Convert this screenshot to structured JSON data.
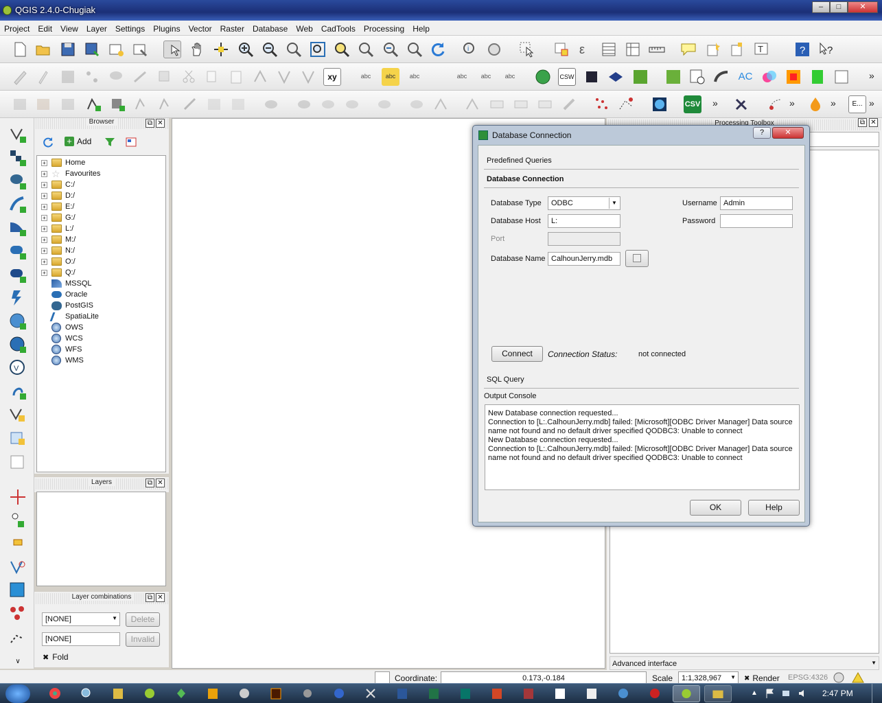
{
  "window": {
    "title": "QGIS 2.4.0-Chugiak"
  },
  "menu": [
    "Project",
    "Edit",
    "View",
    "Layer",
    "Settings",
    "Plugins",
    "Vector",
    "Raster",
    "Database",
    "Web",
    "CadTools",
    "Processing",
    "Help"
  ],
  "toolbars": {
    "row1_icons": [
      "new-project-icon",
      "open-project-icon",
      "save-project-icon",
      "save-as-icon",
      "new-print-composer-icon",
      "composer-manager-icon",
      "touch-zoom-icon",
      "pan-icon",
      "pan-to-selection-icon",
      "zoom-in-icon",
      "zoom-out-icon",
      "zoom-native-icon",
      "zoom-full-icon",
      "zoom-to-layer-icon",
      "zoom-to-selection-icon",
      "zoom-last-icon",
      "zoom-next-icon",
      "refresh-icon",
      "identify-icon",
      "action-icon",
      "select-icon",
      "deselect-icon",
      "measure-icon",
      "attribute-table-icon",
      "field-calculator-icon",
      "ruler-icon",
      "map-tips-icon",
      "bookmark-icon",
      "new-bookmark-icon",
      "text-annotation-icon",
      "help-icon",
      "whats-this-icon"
    ],
    "row2_abc": [
      "abc",
      "abc",
      "abc",
      "abc",
      "abc",
      "abc"
    ],
    "row2_labels": {
      "xy": "xy",
      "csw": "CSW",
      "ac": "AC"
    },
    "row3_labels": {
      "csv": "CSV",
      "more": "»",
      "edit": "E..."
    }
  },
  "browser": {
    "title": "Browser",
    "add_label": "Add",
    "items": [
      {
        "label": "Home",
        "type": "folder",
        "expand": true
      },
      {
        "label": "Favourites",
        "type": "star",
        "expand": true
      },
      {
        "label": "C:/",
        "type": "folder",
        "expand": true
      },
      {
        "label": "D:/",
        "type": "folder",
        "expand": true
      },
      {
        "label": "E:/",
        "type": "folder",
        "expand": true
      },
      {
        "label": "G:/",
        "type": "folder",
        "expand": true
      },
      {
        "label": "L:/",
        "type": "folder",
        "expand": true
      },
      {
        "label": "M:/",
        "type": "folder",
        "expand": true
      },
      {
        "label": "N:/",
        "type": "folder",
        "expand": true
      },
      {
        "label": "O:/",
        "type": "folder",
        "expand": true
      },
      {
        "label": "Q:/",
        "type": "folder",
        "expand": true
      },
      {
        "label": "MSSQL",
        "type": "mssql",
        "expand": false
      },
      {
        "label": "Oracle",
        "type": "oracle",
        "expand": false
      },
      {
        "label": "PostGIS",
        "type": "postgis",
        "expand": false
      },
      {
        "label": "SpatiaLite",
        "type": "spatialite",
        "expand": false
      },
      {
        "label": "OWS",
        "type": "globe",
        "expand": false
      },
      {
        "label": "WCS",
        "type": "globe",
        "expand": false
      },
      {
        "label": "WFS",
        "type": "globe",
        "expand": false
      },
      {
        "label": "WMS",
        "type": "globe",
        "expand": false
      }
    ]
  },
  "layers": {
    "title": "Layers"
  },
  "layer_combinations": {
    "title": "Layer combinations",
    "select_value": "[NONE]",
    "text_value": "[NONE]",
    "delete_label": "Delete",
    "invalid_label": "Invalid",
    "fold_label": "Fold",
    "fold_mark": "✖"
  },
  "processing": {
    "title": "Processing Toolbox",
    "advanced": "Advanced interface"
  },
  "dialog": {
    "title": "Database Connection",
    "help_glyph": "?",
    "close_glyph": "✕",
    "sections": {
      "predefined": "Predefined Queries",
      "connection": "Database Connection",
      "sql": "SQL Query",
      "output": "Output Console"
    },
    "labels": {
      "db_type": "Database Type",
      "db_host": "Database Host",
      "port": "Port",
      "db_name": "Database Name",
      "username": "Username",
      "password": "Password",
      "connection_status": "Connection Status:"
    },
    "values": {
      "db_type": "ODBC",
      "db_host": "L:",
      "port": "",
      "db_name": "CalhounJerry.mdb",
      "username": "Admin",
      "password": "",
      "status": "not connected"
    },
    "buttons": {
      "connect": "Connect",
      "ok": "OK",
      "help": "Help"
    },
    "console_lines": [
      "New Database connection requested...",
      "Connection to [L:.CalhounJerry.mdb] failed: [Microsoft][ODBC Driver Manager] Data source name not found and no default driver specified QODBC3: Unable to connect",
      "New Database connection requested...",
      "Connection to [L:.CalhounJerry.mdb] failed: [Microsoft][ODBC Driver Manager] Data source name not found and no default driver specified QODBC3: Unable to connect"
    ]
  },
  "status": {
    "coordinate_label": "Coordinate:",
    "coordinate": "0.173,-0.184",
    "scale_label": "Scale",
    "scale": "1:1,328,967",
    "render": "Render",
    "render_mark": "✖",
    "crs": "EPSG:4326"
  },
  "taskbar": {
    "time": "2:47 PM"
  },
  "colors": {
    "accent": "#2a4a9c",
    "qgis_green": "#4c9a2a",
    "dialog_frame": "#bcc9d9"
  }
}
